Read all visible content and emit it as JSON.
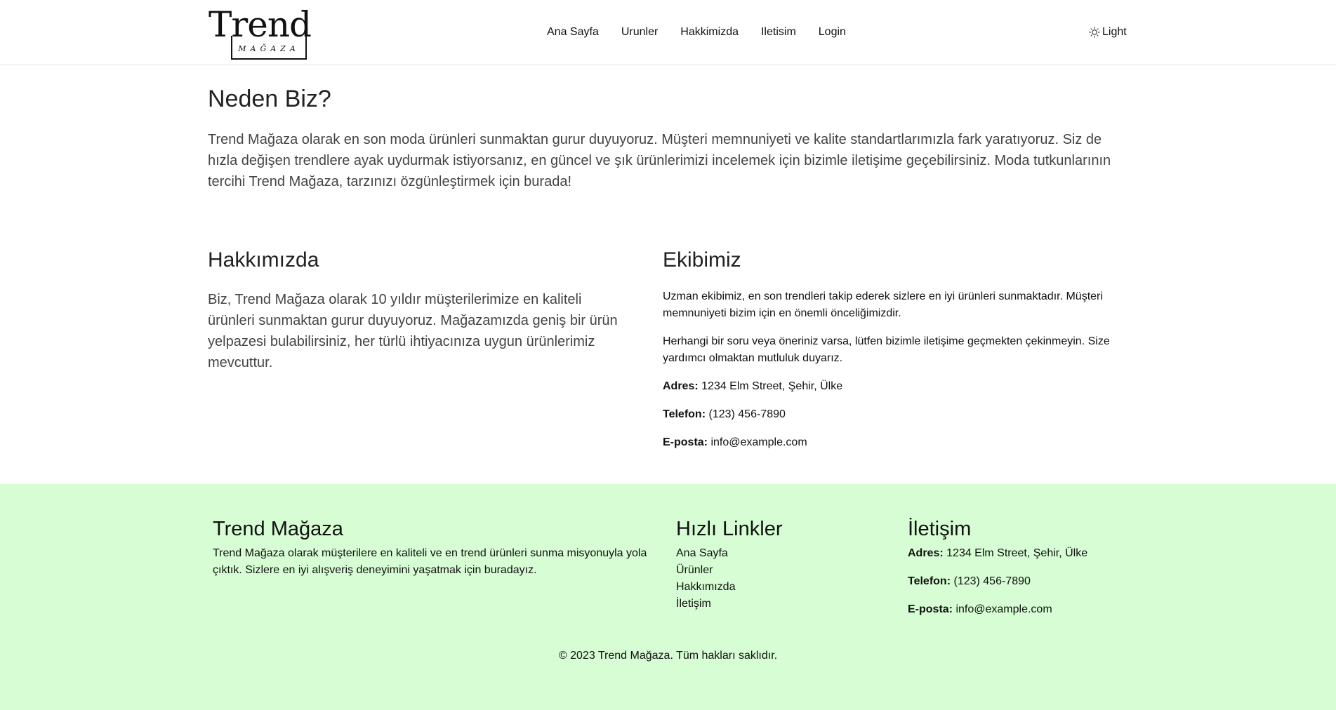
{
  "header": {
    "logo": {
      "word": "Trend",
      "sub": "MAĞAZA"
    },
    "nav": [
      "Ana Sayfa",
      "Urunler",
      "Hakkimizda",
      "Iletisim",
      "Login"
    ],
    "theme_label": "Light"
  },
  "main": {
    "why_title": "Neden Biz?",
    "why_text": "Trend Mağaza olarak en son moda ürünleri sunmaktan gurur duyuyoruz. Müşteri memnuniyeti ve kalite standartlarımızla fark yaratıyoruz. Siz de hızla değişen trendlere ayak uydurmak istiyorsanız, en güncel ve şık ürünlerimizi incelemek için bizimle iletişime geçebilirsiniz. Moda tutkunlarının tercihi Trend Mağaza, tarzınızı özgünleştirmek için burada!",
    "about_title": "Hakkımızda",
    "about_text": "Biz, Trend Mağaza olarak 10 yıldır müşterilerimize en kaliteli ürünleri sunmaktan gurur duyuyoruz. Mağazamızda geniş bir ürün yelpazesi bulabilirsiniz, her türlü ihtiyacınıza uygun ürünlerimiz mevcuttur.",
    "team_title": "Ekibimiz",
    "team_p1": "Uzman ekibimiz, en son trendleri takip ederek sizlere en iyi ürünleri sunmaktadır. Müşteri memnuniyeti bizim için en önemli önceliğimizdir.",
    "team_p2": "Herhangi bir soru veya öneriniz varsa, lütfen bizimle iletişime geçmekten çekinmeyin. Size yardımcı olmaktan mutluluk duyarız.",
    "address_label": "Adres:",
    "address": "1234 Elm Street, Şehir, Ülke",
    "phone_label": "Telefon:",
    "phone": "(123) 456-7890",
    "email_label": "E-posta:",
    "email": "info@example.com"
  },
  "footer": {
    "brand_title": "Trend Mağaza",
    "brand_text": "Trend Mağaza olarak müşterilere en kaliteli ve en trend ürünleri sunma misyonuyla yola çıktık. Sizlere en iyi alışveriş deneyimini yaşatmak için buradayız.",
    "links_title": "Hızlı Linkler",
    "links": [
      "Ana Sayfa",
      "Ürünler",
      "Hakkımızda",
      "İletişim"
    ],
    "contact_title": "İletişim",
    "address_label": "Adres:",
    "address": "1234 Elm Street, Şehir, Ülke",
    "phone_label": "Telefon:",
    "phone": "(123) 456-7890",
    "email_label": "E-posta:",
    "email": "info@example.com",
    "copyright": "© 2023 Trend Mağaza. Tüm hakları saklıdır."
  }
}
